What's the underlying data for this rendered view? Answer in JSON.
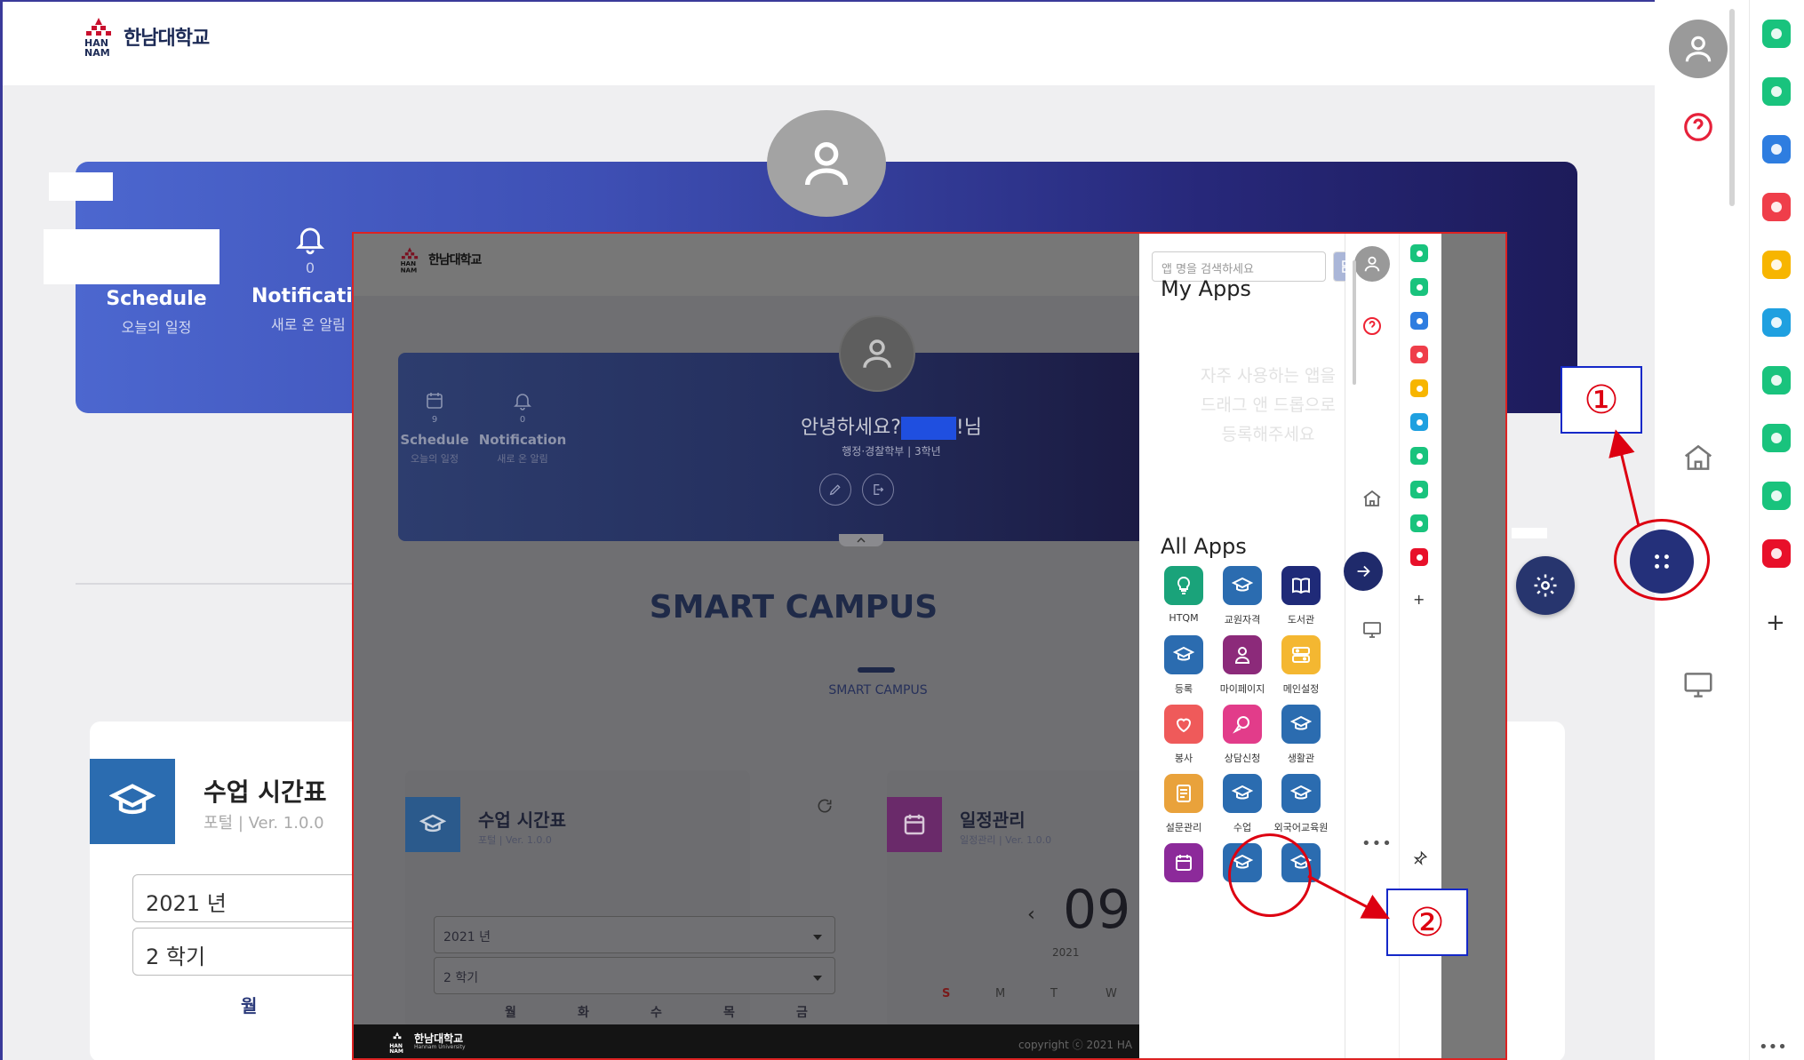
{
  "colors": {
    "brand_navy": "#24307a",
    "accent_red": "#d01010",
    "callout_blue": "#1428c8"
  },
  "background": {
    "logo_text": "한남대학교",
    "logo_mark": "HAN NAM",
    "schedule": {
      "title": "Schedule",
      "subtitle": "오늘의 일정"
    },
    "notification": {
      "title": "Notificati",
      "subtitle": "새로 온 알림",
      "count": "0"
    },
    "timetable": {
      "title": "수업 시간표",
      "meta": "포털  |  Ver. 1.0.0",
      "year": "2021 년",
      "term": "2 학기",
      "day": "월"
    }
  },
  "inset": {
    "logo_text": "한남대학교",
    "schedule": {
      "title": "Schedule",
      "subtitle": "오늘의 일정",
      "count": "9"
    },
    "notification": {
      "title": "Notification",
      "subtitle": "새로 온 알림",
      "count": "0"
    },
    "greeting_prefix": "안녕하세요?",
    "greeting_suffix": "!님",
    "user_info": "행정·경찰학부  |  3학년",
    "page_title": "SMART CAMPUS",
    "page_subtitle": "SMART CAMPUS",
    "timetable_card": {
      "title": "수업 시간표",
      "meta": "포털  |  Ver. 1.0.0",
      "year": "2021 년",
      "term": "2 학기",
      "days": [
        "월",
        "화",
        "수",
        "목",
        "금"
      ]
    },
    "schedule_card": {
      "title": "일정관리",
      "meta": "일정관리  |  Ver. 1.0.0",
      "date_big": "09",
      "year_small": "2021",
      "cal_days": [
        "S",
        "M",
        "T",
        "W"
      ]
    },
    "footer_logo": "한남대학교",
    "footer_logo_sub": "Hannam University",
    "copyright": "copyright ⓒ 2021 HA"
  },
  "drawer": {
    "search_placeholder": "앱 명을 검색하세요",
    "my_apps_title": "My Apps",
    "drag_hint": [
      "자주 사용하는 앱을",
      "드래그 앤 드롭으로",
      "등록해주세요"
    ],
    "all_apps_title": "All Apps",
    "apps": [
      {
        "label": "HTQM",
        "icon": "lightbulb-icon",
        "color": "#1aa37a"
      },
      {
        "label": "교원자격",
        "icon": "graduation-cap-icon",
        "color": "#2b6cb0"
      },
      {
        "label": "도서관",
        "icon": "book-icon",
        "color": "#1f2a78"
      },
      {
        "label": "등록",
        "icon": "graduation-cap-icon",
        "color": "#2b6cb0"
      },
      {
        "label": "마이페이지",
        "icon": "user-icon",
        "color": "#8c2a7a"
      },
      {
        "label": "메인설정",
        "icon": "settings-tiles-icon",
        "color": "#f4b731"
      },
      {
        "label": "봉사",
        "icon": "heart-hand-icon",
        "color": "#ef5a5a"
      },
      {
        "label": "상담신청",
        "icon": "chat-icon",
        "color": "#e23c8a"
      },
      {
        "label": "생활관",
        "icon": "graduation-cap-icon",
        "color": "#2b6cb0"
      },
      {
        "label": "설문관리",
        "icon": "survey-icon",
        "color": "#e9a23b"
      },
      {
        "label": "수업",
        "icon": "graduation-cap-icon",
        "color": "#2b6cb0"
      },
      {
        "label": "외국어교육원",
        "icon": "graduation-cap-icon",
        "color": "#2b6cb0"
      },
      {
        "label": "",
        "icon": "calendar-icon",
        "color": "#8c2a9a"
      },
      {
        "label": "",
        "icon": "graduation-cap-icon",
        "color": "#2b6cb0"
      },
      {
        "label": "",
        "icon": "graduation-cap-icon",
        "color": "#2b6cb0"
      }
    ]
  },
  "annotations": {
    "callout_1": "①",
    "callout_2": "②"
  },
  "right_strip_icons": [
    {
      "name": "green-ring-icon",
      "color": "#19c37d"
    },
    {
      "name": "bell-app-icon",
      "color": "#19c37d"
    },
    {
      "name": "briefcase-app-icon",
      "color": "#2e7de0"
    },
    {
      "name": "pocket-app-icon",
      "color": "#ef3e4a"
    },
    {
      "name": "star-app-icon",
      "color": "#f7b500"
    },
    {
      "name": "edge-app-icon",
      "color": "#1fa0e0"
    },
    {
      "name": "play-app-icon",
      "color": "#19c37d"
    },
    {
      "name": "webtoon-app-icon",
      "color": "#19c37d"
    },
    {
      "name": "green-square-app-icon",
      "color": "#19c37d"
    },
    {
      "name": "now-app-icon",
      "color": "#e8102a"
    }
  ]
}
